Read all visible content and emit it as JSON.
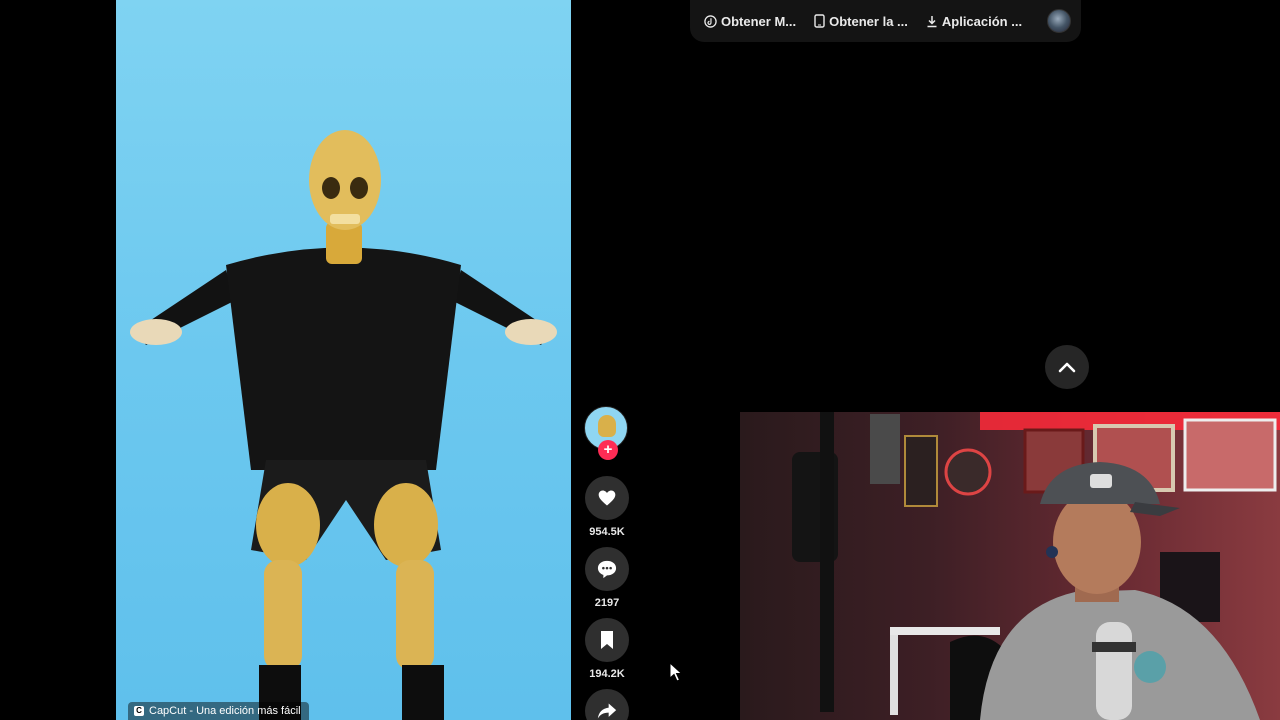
{
  "topbar": {
    "items": [
      {
        "label": "Obtener M...",
        "icon": "tiktok-coin-icon"
      },
      {
        "label": "Obtener la ...",
        "icon": "phone-icon"
      },
      {
        "label": "Aplicación ...",
        "icon": "download-icon"
      }
    ]
  },
  "video": {
    "watermark": "CapCut - Una edición más fácil"
  },
  "actions": {
    "likes": "954.5K",
    "comments": "2197",
    "saves": "194.2K"
  },
  "colors": {
    "follow_accent": "#fe2c55",
    "video_background": "#6cc8ef"
  }
}
